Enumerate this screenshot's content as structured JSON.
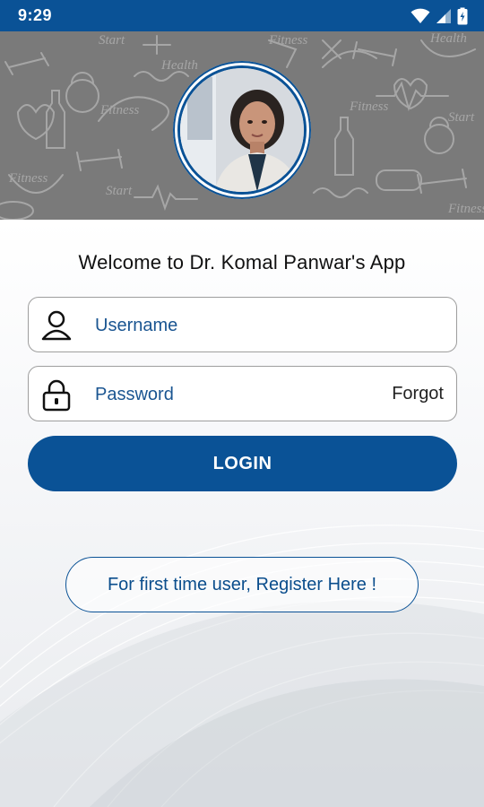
{
  "status_bar": {
    "time": "9:29",
    "icons": [
      "wifi-icon",
      "signal-icon",
      "battery-icon"
    ]
  },
  "header": {
    "background_color": "#7a7a7a",
    "pattern_words": [
      "Start",
      "Fitness",
      "Health",
      "Fitness",
      "Start",
      "Fitness",
      "Health",
      "Fitness",
      "Start",
      "Fitness"
    ],
    "profile_photo": "doctor-avatar"
  },
  "login": {
    "welcome_text": "Welcome to Dr. Komal Panwar's App",
    "username_placeholder": "Username",
    "password_placeholder": "Password",
    "forgot_label": "Forgot",
    "login_label": "LOGIN",
    "register_label": "For first time user, Register Here !"
  },
  "colors": {
    "primary": "#0a5296",
    "field_text": "#1a5591",
    "border": "#9e9e9e"
  }
}
